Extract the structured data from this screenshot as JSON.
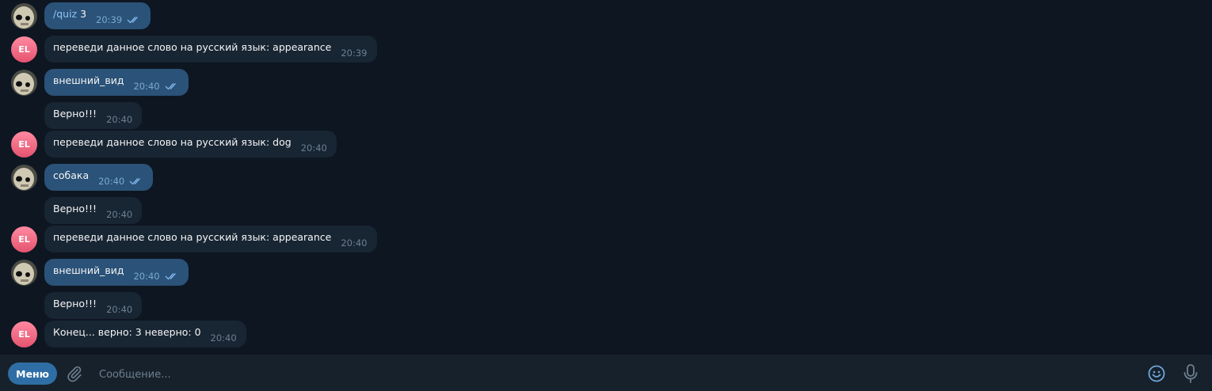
{
  "messages": [
    {
      "dir": "out",
      "text": "/quiz",
      "arg": "3",
      "time": "20:39",
      "read": true
    },
    {
      "dir": "in",
      "sender": "EL",
      "text": "переведи данное слово на русский язык: appearance",
      "time": "20:39"
    },
    {
      "dir": "out",
      "text": "внешний_вид",
      "time": "20:40",
      "read": true
    },
    {
      "dir": "in",
      "text": "Верно!!!",
      "time": "20:40"
    },
    {
      "dir": "in",
      "sender": "EL",
      "text": "переведи данное слово на русский язык: dog",
      "time": "20:40"
    },
    {
      "dir": "out",
      "text": "собака",
      "time": "20:40",
      "read": true
    },
    {
      "dir": "in",
      "text": "Верно!!!",
      "time": "20:40"
    },
    {
      "dir": "in",
      "sender": "EL",
      "text": "переведи данное слово на русский язык: appearance",
      "time": "20:40"
    },
    {
      "dir": "out",
      "text": "внешний_вид",
      "time": "20:40",
      "read": true
    },
    {
      "dir": "in",
      "text": "Верно!!!",
      "time": "20:40"
    },
    {
      "dir": "in",
      "sender": "EL",
      "text": "Конец... верно: 3 неверно: 0",
      "time": "20:40"
    }
  ],
  "avatar_initials": "EL",
  "composer": {
    "menu_label": "Меню",
    "placeholder": "Сообщение...",
    "icons": [
      "paperclip-icon",
      "emoji-icon",
      "microphone-icon"
    ]
  },
  "colors": {
    "background": "#0e1621",
    "outgoing_bubble": "#2b5278",
    "incoming_bubble": "#182533",
    "composer_bg": "#17212b",
    "menu_button": "#2f6ea5",
    "avatar_el": "#e5536f",
    "read_check": "#7db3e8"
  }
}
